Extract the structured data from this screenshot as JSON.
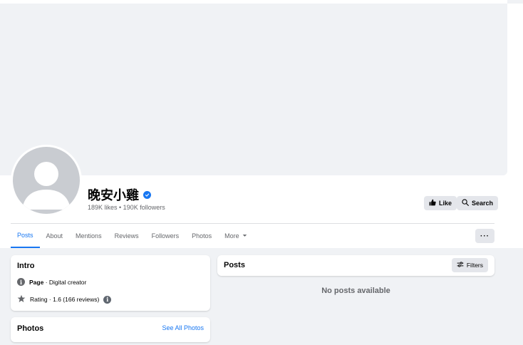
{
  "profile": {
    "name": "晚安小雞",
    "stats": "189K likes • 190K followers"
  },
  "actions": {
    "like_label": "Like",
    "search_label": "Search",
    "more_label": "···"
  },
  "tabs": [
    {
      "label": "Posts",
      "active": true
    },
    {
      "label": "About"
    },
    {
      "label": "Mentions"
    },
    {
      "label": "Reviews"
    },
    {
      "label": "Followers"
    },
    {
      "label": "Photos"
    },
    {
      "label": "More"
    }
  ],
  "intro": {
    "title": "Intro",
    "page_label": "Page",
    "page_category": " · Digital creator",
    "rating": "Rating · 1.6 (166 reviews)"
  },
  "photos": {
    "title": "Photos",
    "see_all": "See All Photos"
  },
  "posts": {
    "title": "Posts",
    "filters_label": "Filters",
    "empty_text": "No posts available"
  },
  "colors": {
    "accent": "#1877f2",
    "muted_text": "#65676b",
    "button_bg": "#e4e6eb",
    "page_bg": "#f0f2f5"
  }
}
